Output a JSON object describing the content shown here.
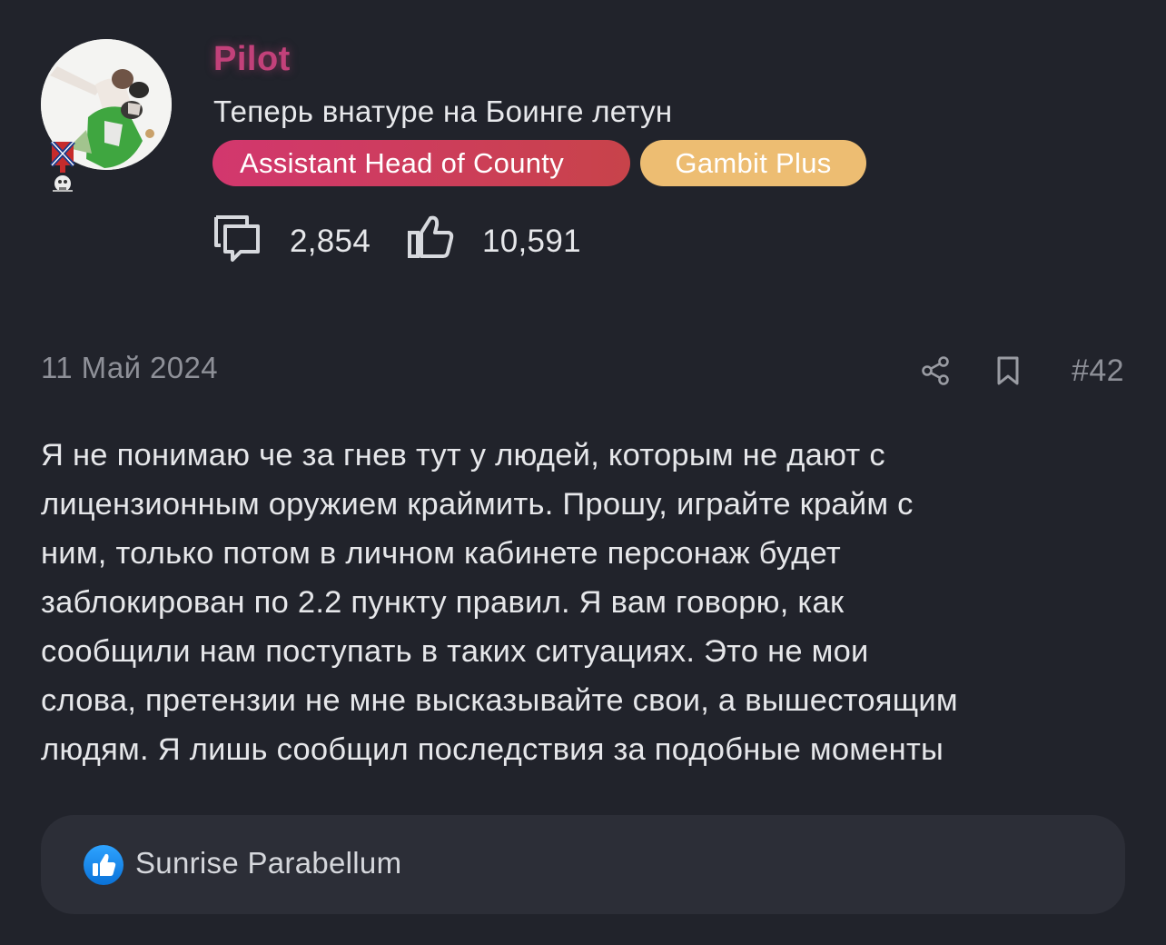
{
  "author": {
    "username": "Pilot",
    "user_title": "Теперь внатуре на Боинге летун",
    "badges": [
      {
        "label": "Assistant Head of County"
      },
      {
        "label": "Gambit Plus"
      }
    ],
    "stats": {
      "messages_icon": "messages-icon",
      "messages_count": "2,854",
      "likes_icon": "thumbs-up-icon",
      "likes_count": "10,591"
    }
  },
  "post": {
    "date": "11 Май 2024",
    "number": "#42",
    "share_icon": "share-icon",
    "bookmark_icon": "bookmark-icon",
    "body": "Я не понимаю че за гнев тут у людей, которым не дают с\nлицензионным оружием краймить. Прошу, играйте крайм с\nним, только потом в личном кабинете персонаж будет\nзаблокирован по 2.2 пункту правил. Я вам говорю, как\nсообщили нам поступать в таких ситуациях. Это не мои\nслова, претензии не мне высказывайте свои, а вышестоящим\nлюдям. Я лишь сообщил последствия за подобные моменты"
  },
  "reactions": {
    "icon": "like-reaction-icon",
    "users": "Sunrise Parabellum"
  },
  "colors": {
    "background": "#21232b",
    "username": "#c2417a",
    "badge_role": "#d2376e",
    "badge_plus": "#edbd72",
    "muted": "#8e9098",
    "reaction_panel": "#2c2e37",
    "like_blue": "#1d8ff2"
  }
}
